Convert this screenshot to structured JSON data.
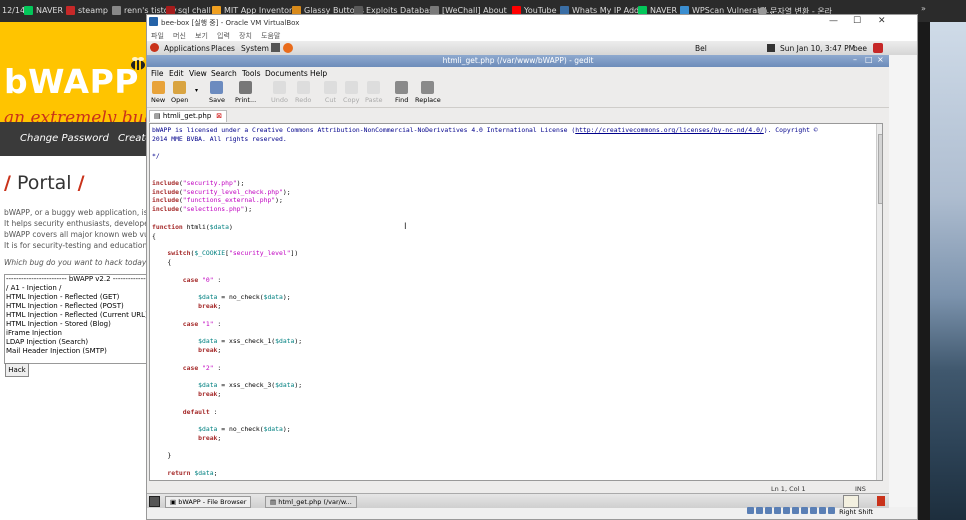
{
  "host": {
    "clock": "12/14",
    "bookmarks": [
      "NAVER",
      "steamp",
      "renn's tistory",
      "sql chall",
      "MIT App Inventor |",
      "Glassy Buttons",
      "Exploits Database",
      "[WeChall] About",
      "YouTube",
      "Whats My IP Addr",
      "NAVER",
      "WPScan Vulnerabil...",
      "문자열 변환 - 온라"
    ],
    "more": "»"
  },
  "bwapp": {
    "logo": "bWAPP",
    "tagline": "an extremely buggy",
    "nav": [
      "Change Password",
      "Create"
    ],
    "portal_word": "Portal",
    "slash": "/",
    "paragraphs": [
      "bWAPP, or a buggy web application, is a",
      "It helps security enthusiasts, developers a",
      "bWAPP covers all major known web vulne",
      "It is for security-testing and educational p"
    ],
    "question": "Which bug do you want to hack today? :)",
    "bug_options": [
      "------------------------ bWAPP v2.2 ------------------------",
      "/ A1 - Injection /",
      "HTML Injection - Reflected (GET)",
      "HTML Injection - Reflected (POST)",
      "HTML Injection - Reflected (Current URL)",
      "HTML Injection - Stored (Blog)",
      "iFrame Injection",
      "LDAP Injection (Search)",
      "Mail Header Injection (SMTP)"
    ],
    "hack_label": "Hack"
  },
  "vbox": {
    "title": "bee-box [실행 중] - Oracle VM VirtualBox",
    "menu": [
      "파일",
      "머신",
      "보기",
      "입력",
      "장치",
      "도움말"
    ],
    "status_right": "Right Shift"
  },
  "gnome": {
    "applications": "Applications",
    "places": "Places",
    "system": "System",
    "user_center": "Bel",
    "datetime": "Sun Jan 10,  3:47 PM",
    "user": "bee",
    "taskbar": [
      "bWAPP - File Browser",
      "html_get.php (/var/w..."
    ]
  },
  "gedit": {
    "title": "htmli_get.php (/var/www/bWAPP) - gedit",
    "menu": [
      "File",
      "Edit",
      "View",
      "Search",
      "Tools",
      "Documents",
      "Help"
    ],
    "toolbar": [
      {
        "label": "New",
        "enabled": true,
        "color": "#e8a33a"
      },
      {
        "label": "Open",
        "enabled": true,
        "color": "#d9a441"
      },
      {
        "label": "Save",
        "enabled": true,
        "color": "#6c8bbf"
      },
      {
        "label": "Print...",
        "enabled": true,
        "color": "#777777"
      },
      {
        "label": "Undo",
        "enabled": false,
        "color": "#dddddd"
      },
      {
        "label": "Redo",
        "enabled": false,
        "color": "#dddddd"
      },
      {
        "label": "Cut",
        "enabled": false,
        "color": "#dddddd"
      },
      {
        "label": "Copy",
        "enabled": false,
        "color": "#dddddd"
      },
      {
        "label": "Paste",
        "enabled": false,
        "color": "#dddddd"
      },
      {
        "label": "Find",
        "enabled": true,
        "color": "#8a8a8a"
      },
      {
        "label": "Replace",
        "enabled": true,
        "color": "#8a8a8a"
      }
    ],
    "tab_label": "htmli_get.php",
    "status": {
      "position": "Ln 1, Col 1",
      "mode": "INS"
    },
    "code": {
      "license_a": "bWAPP is licensed under a Creative Commons Attribution-NonCommercial-NoDerivatives 4.0 International License (",
      "license_link": "http://creativecommons.org/licenses/by-nc-nd/4.0/",
      "license_b": "). Copyright ©",
      "license_c": "2014 MME BVBA. All rights reserved.",
      "comment_end": "*/",
      "include_kw": "include",
      "includes": [
        "\"security.php\"",
        "\"security_level_check.php\"",
        "\"functions_external.php\"",
        "\"selections.php\""
      ],
      "function_kw": "function",
      "func_name": "htmli(",
      "param": "$data",
      "switch_kw": "switch",
      "cookie": "$_COOKIE",
      "cookie_key": "\"security_level\"",
      "case_kw": "case",
      "case_vals": [
        "\"0\"",
        "\"1\"",
        "\"2\""
      ],
      "default_kw": "default",
      "break_kw": "break",
      "return_kw": "return",
      "calls": [
        "no_check(",
        "xss_check_1(",
        "xss_check_3(",
        "no_check("
      ]
    }
  },
  "colors": {
    "bwapp_yellow": "#ffc400",
    "bwapp_red": "#c9321a",
    "gedit_title": "#6d8cba"
  }
}
